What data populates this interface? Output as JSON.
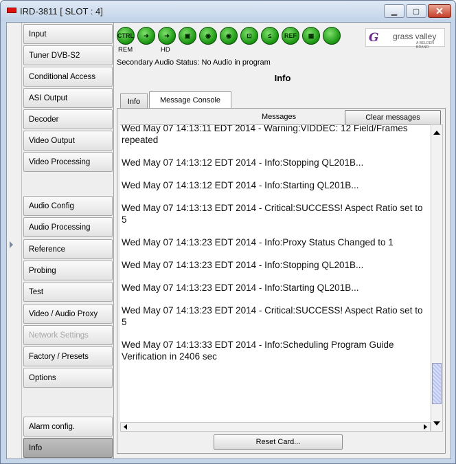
{
  "window": {
    "title": "IRD-3811 [ SLOT : 4]",
    "minimize_icon": "minimize-icon",
    "maximize_icon": "maximize-icon",
    "close_icon": "close-icon"
  },
  "nav": {
    "items": [
      {
        "label": "Input",
        "state": "normal"
      },
      {
        "label": "Tuner DVB-S2",
        "state": "normal"
      },
      {
        "label": "Conditional Access",
        "state": "normal"
      },
      {
        "label": "ASI Output",
        "state": "normal"
      },
      {
        "label": "Decoder",
        "state": "normal"
      },
      {
        "label": "Video Output",
        "state": "normal"
      },
      {
        "label": "Video Processing",
        "state": "normal"
      },
      {
        "label": "Audio Config",
        "state": "normal"
      },
      {
        "label": "Audio Processing",
        "state": "normal"
      },
      {
        "label": "Reference",
        "state": "normal"
      },
      {
        "label": "Probing",
        "state": "normal"
      },
      {
        "label": "Test",
        "state": "normal"
      },
      {
        "label": "Video / Audio Proxy",
        "state": "normal"
      },
      {
        "label": "Network Settings",
        "state": "disabled"
      },
      {
        "label": "Factory / Presets",
        "state": "normal"
      },
      {
        "label": "Options",
        "state": "normal"
      },
      {
        "label": "Alarm config.",
        "state": "normal"
      },
      {
        "label": "Info",
        "state": "active"
      }
    ]
  },
  "status_icons": {
    "icons": [
      {
        "name": "ctrl-icon",
        "glyph": "CTRL"
      },
      {
        "name": "arrow-right-icon",
        "glyph": "➜"
      },
      {
        "name": "arrow-right-icon",
        "glyph": "➜"
      },
      {
        "name": "camera-icon",
        "glyph": "▣"
      },
      {
        "name": "audio-icon",
        "glyph": "◉"
      },
      {
        "name": "audio-icon",
        "glyph": "◉"
      },
      {
        "name": "lock-icon",
        "glyph": "⊡"
      },
      {
        "name": "less-equal-icon",
        "glyph": "≤"
      },
      {
        "name": "ref-icon",
        "glyph": "REF"
      },
      {
        "name": "monitor-icon",
        "glyph": "▦"
      },
      {
        "name": "status-light-icon",
        "glyph": ""
      }
    ],
    "label_rem": "REM",
    "label_hd": "HD"
  },
  "logo": {
    "text": "grass valley",
    "subtext": "A BELDEN BRAND",
    "mark": "G"
  },
  "secondary_audio": "Secondary Audio Status: No Audio in program",
  "panel_title": "Info",
  "tabs": [
    {
      "label": "Info",
      "selected": false
    },
    {
      "label": "Message Console",
      "selected": true
    }
  ],
  "console": {
    "header": "Messages",
    "clear_label": "Clear messages",
    "messages": [
      "Wed May 07 14:13:11 EDT 2014 - Warning:VIDDEC: 12 Field/Frames repeated",
      "Wed May 07 14:13:12 EDT 2014 - Info:Stopping QL201B...",
      "Wed May 07 14:13:12 EDT 2014 - Info:Starting QL201B...",
      "Wed May 07 14:13:13 EDT 2014 - Critical:SUCCESS!  Aspect Ratio set to 5",
      "Wed May 07 14:13:23 EDT 2014 - Info:Proxy Status Changed to 1",
      "Wed May 07 14:13:23 EDT 2014 - Info:Stopping QL201B...",
      "Wed May 07 14:13:23 EDT 2014 - Info:Starting QL201B...",
      "Wed May 07 14:13:23 EDT 2014 - Critical:SUCCESS!  Aspect Ratio set to 5",
      "Wed May 07 14:13:33 EDT 2014 - Info:Scheduling Program Guide Verification in 2406 sec"
    ],
    "reset_label": "Reset Card..."
  }
}
